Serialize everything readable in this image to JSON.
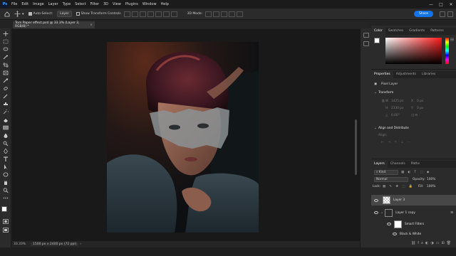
{
  "menubar": {
    "logo": "Ps",
    "items": [
      "File",
      "Edit",
      "Image",
      "Layer",
      "Type",
      "Select",
      "Filter",
      "3D",
      "View",
      "Plugins",
      "Window",
      "Help"
    ],
    "window_controls": [
      "—",
      "□",
      "✕"
    ]
  },
  "options": {
    "auto_select_label": "Auto-Select:",
    "auto_select_target": "Layer",
    "transform_controls_label": "Show Transform Controls",
    "mode_3d": "3D Mode:",
    "share_label": "Share"
  },
  "document": {
    "tab_title": "Torn Paper effect.psd @ 33.3% (Layer 3, RGB/8) *",
    "zoom": "33.33%",
    "info": "1500 px x 2400 px (72 ppi)"
  },
  "panels": {
    "color_tabs": [
      "Color",
      "Swatches",
      "Gradients",
      "Patterns"
    ],
    "properties_tabs": [
      "Properties",
      "Adjustments",
      "Libraries"
    ],
    "pixel_layer_label": "Pixel Layer",
    "transform_heading": "Transform",
    "transform_fields": {
      "w": "1425 px",
      "h": "2330 px",
      "x": "0 px",
      "y": "0 px",
      "angle": "0.00°"
    },
    "align_heading": "Align and Distribute",
    "align_label": "Align:",
    "layers_tabs": [
      "Layers",
      "Channels",
      "Paths"
    ],
    "kind_filter": "Kind",
    "blend_mode": "Normal",
    "opacity_label": "Opacity:",
    "opacity_value": "100%",
    "lock_label": "Lock:",
    "fill_label": "Fill:",
    "fill_value": "100%",
    "layers": [
      {
        "name": "Layer 3"
      },
      {
        "name": "Layer 1 copy"
      },
      {
        "name": "Smart Filters"
      },
      {
        "name": "Black & White"
      }
    ]
  },
  "colors": {
    "accent": "#1473e6",
    "panel_bg": "#2b2b2b",
    "canvas_bg": "#191919"
  }
}
